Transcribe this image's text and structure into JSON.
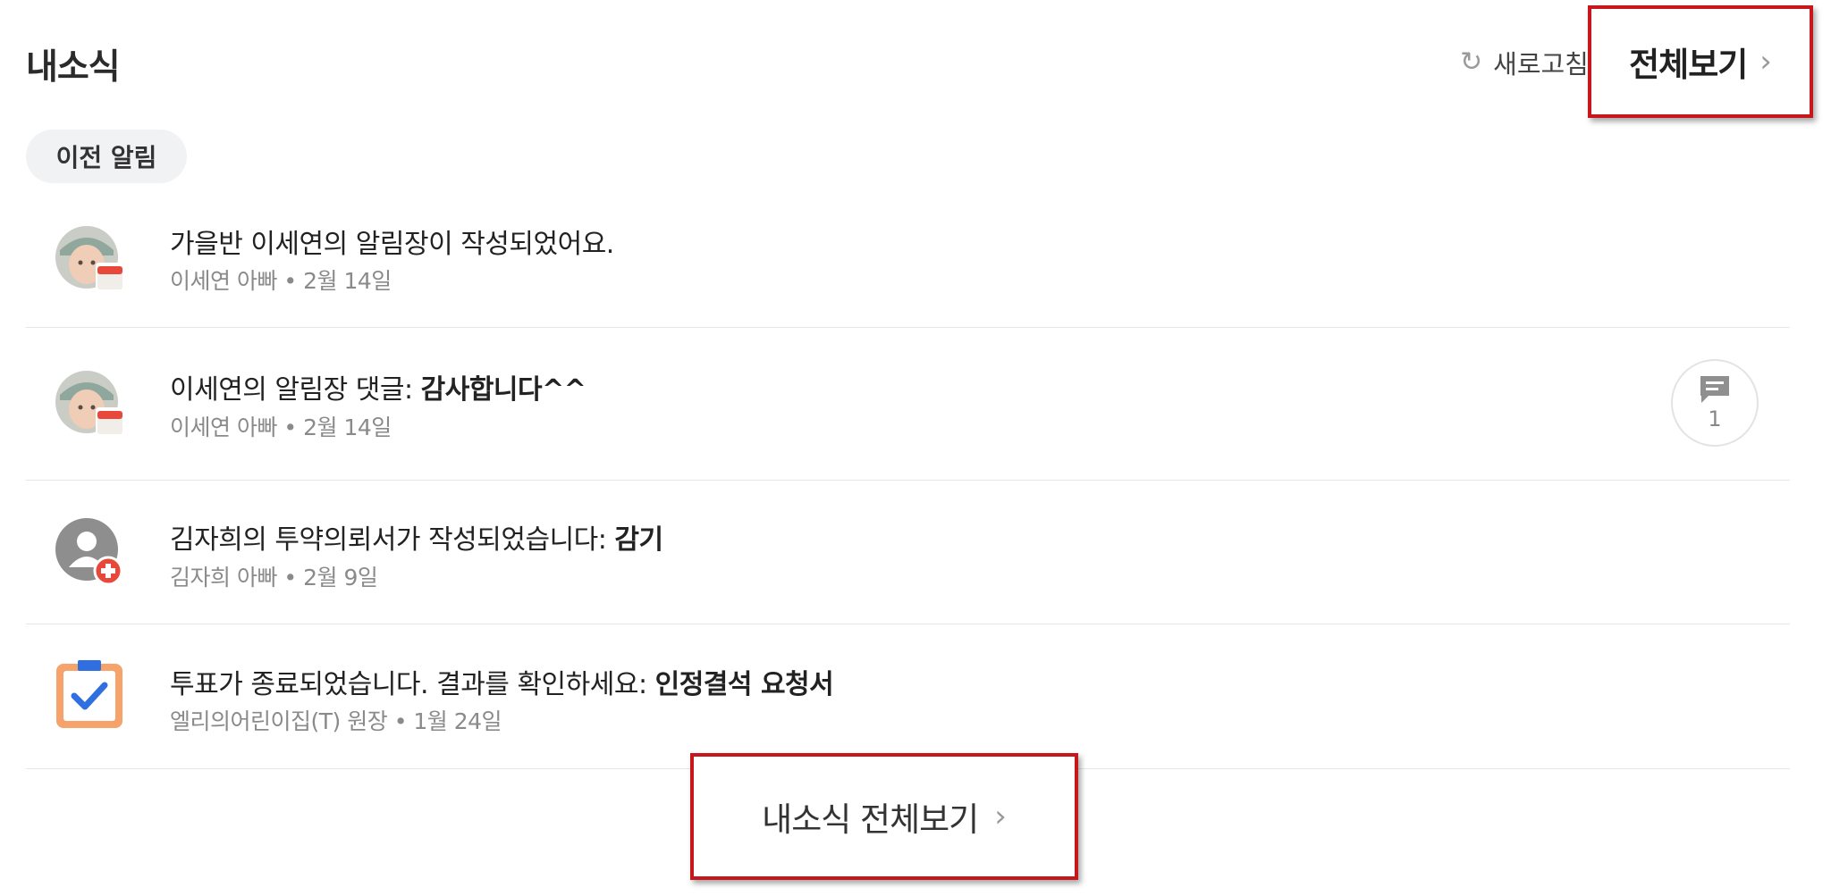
{
  "header": {
    "title": "내소식",
    "refresh_label": "새로고침",
    "view_all_label": "전체보기"
  },
  "filter": {
    "previous_label": "이전 알림"
  },
  "notifications": [
    {
      "title": "가을반 이세연의 알림장이 작성되었어요.",
      "title_bold": "",
      "author": "이세연 아빠",
      "date": "2월 14일",
      "icon": "child-photo-avatar-with-calendar-badge"
    },
    {
      "title": "이세연의 알림장 댓글: ",
      "title_bold": "감사합니다^^",
      "author": "이세연 아빠",
      "date": "2월 14일",
      "icon": "child-photo-avatar-with-calendar-badge",
      "comment_count": "1"
    },
    {
      "title": "김자희의 투약의뢰서가 작성되었습니다: ",
      "title_bold": "감기",
      "author": "김자희 아빠",
      "date": "2월 9일",
      "icon": "person-avatar-with-medical-badge"
    },
    {
      "title": "투표가 종료되었습니다. 결과를 확인하세요: ",
      "title_bold": "인정결석 요청서",
      "author": "엘리의어린이집(T) 원장",
      "date": "1월 24일",
      "icon": "vote-checkbox-icon"
    }
  ],
  "footer": {
    "view_all_label": "내소식 전체보기"
  },
  "separator": "•",
  "colors": {
    "highlight_border": "#c8161d",
    "vote_orange": "#f5a36a",
    "vote_blue": "#2f6fe0",
    "badge_red": "#e8483a"
  }
}
